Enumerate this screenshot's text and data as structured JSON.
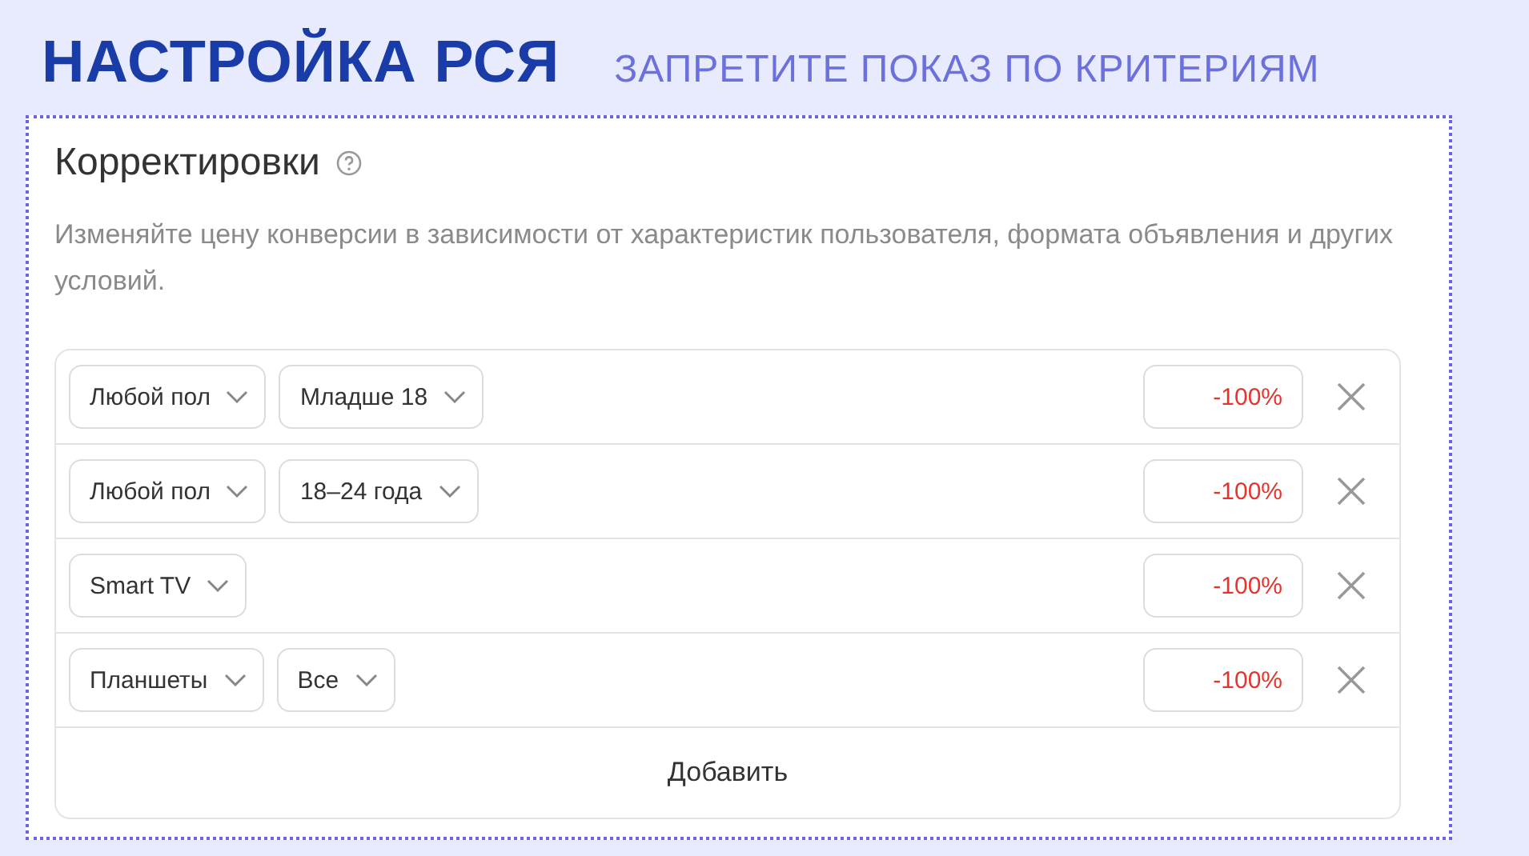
{
  "header": {
    "title": "НАСТРОЙКА РСЯ",
    "subtitle": "ЗАПРЕТИТЕ ПОКАЗ ПО КРИТЕРИЯМ"
  },
  "section": {
    "title": "Корректировки",
    "description": "Изменяйте цену конверсии в зависимости от характеристик пользователя, формата объявления и других условий."
  },
  "adjustments": [
    {
      "selects": [
        "Любой пол",
        "Младше 18"
      ],
      "value": "-100%"
    },
    {
      "selects": [
        "Любой пол",
        "18–24 года"
      ],
      "value": "-100%"
    },
    {
      "selects": [
        "Smart TV"
      ],
      "value": "-100%"
    },
    {
      "selects": [
        "Планшеты",
        "Все"
      ],
      "value": "-100%"
    }
  ],
  "add_button": "Добавить"
}
